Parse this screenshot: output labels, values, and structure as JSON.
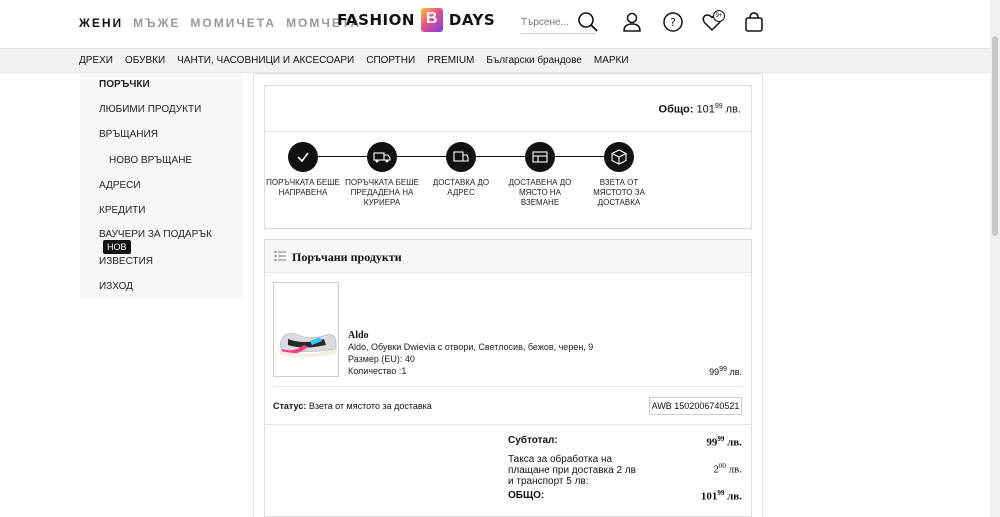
{
  "header": {
    "gender_tabs": [
      "ЖЕНИ",
      "МЪЖЕ",
      "МОМИЧЕТА",
      "МОМЧЕТА"
    ],
    "logo_left": "FASHION",
    "logo_right": "DAYS",
    "search_placeholder": "Търсене...",
    "wishlist_count": "9+"
  },
  "categories": [
    "ДРЕХИ",
    "ОБУВКИ",
    "ЧАНТИ, ЧАСОВНИЦИ И АКСЕСОАРИ",
    "СПОРТНИ",
    "PREMIUM",
    "Български брандове",
    "МАРКИ"
  ],
  "sidebar": {
    "items": [
      "ПОРЪЧКИ",
      "ЛЮБИМИ ПРОДУКТИ",
      "ВРЪЩАНИЯ",
      "НОВО ВРЪЩАНЕ",
      "АДРЕСИ",
      "КРЕДИТИ",
      "ВАУЧЕРИ ЗА ПОДАРЪК",
      "ИЗВЕСТИЯ",
      "ИЗХОД"
    ],
    "new_badge": "НОВ"
  },
  "order": {
    "total_label": "Общо:",
    "total_int": "101",
    "total_dec": "99",
    "currency": "лв.",
    "steps": [
      {
        "label": "ПОРЪЧКАТА БЕШЕ НАПРАВЕНА",
        "icon": "check-icon"
      },
      {
        "label": "ПОРЪЧКАТА БЕШЕ ПРЕДАДЕНА НА КУРИЕРА",
        "icon": "truck-icon"
      },
      {
        "label": "ДОСТАВКА ДО АДРЕС",
        "icon": "delivery-icon"
      },
      {
        "label": "ДОСТАВЕНА ДО МЯСТО НА ВЗЕМАНЕ",
        "icon": "store-icon"
      },
      {
        "label": "ВЗЕТА ОТ МЯСТОТО ЗА ДОСТАВКА",
        "icon": "package-icon"
      }
    ]
  },
  "products": {
    "title": "Поръчани продукти",
    "item": {
      "brand": "Aldo",
      "name": "Aldo, Обувки Dwievia с отвори, Светлосив, бежов, черен, 9",
      "size": "Размер (EU): 40",
      "qty": "Количество :1",
      "price_int": "99",
      "price_dec": "99",
      "currency": "лв."
    },
    "status_label": "Статус:",
    "status_value": "Взета от мястото за доставка",
    "awb": "AWB 1502006740521"
  },
  "summary": {
    "subtotal_label": "Субтотал:",
    "subtotal_int": "99",
    "subtotal_dec": "99",
    "fee_label": "Такса за обработка на плащане при доставка 2 лв и транспорт 5 лв:",
    "fee_int": "2",
    "fee_dec": "00",
    "total_label": "ОБЩО:",
    "total_int": "101",
    "total_dec": "99",
    "currency": "лв."
  }
}
